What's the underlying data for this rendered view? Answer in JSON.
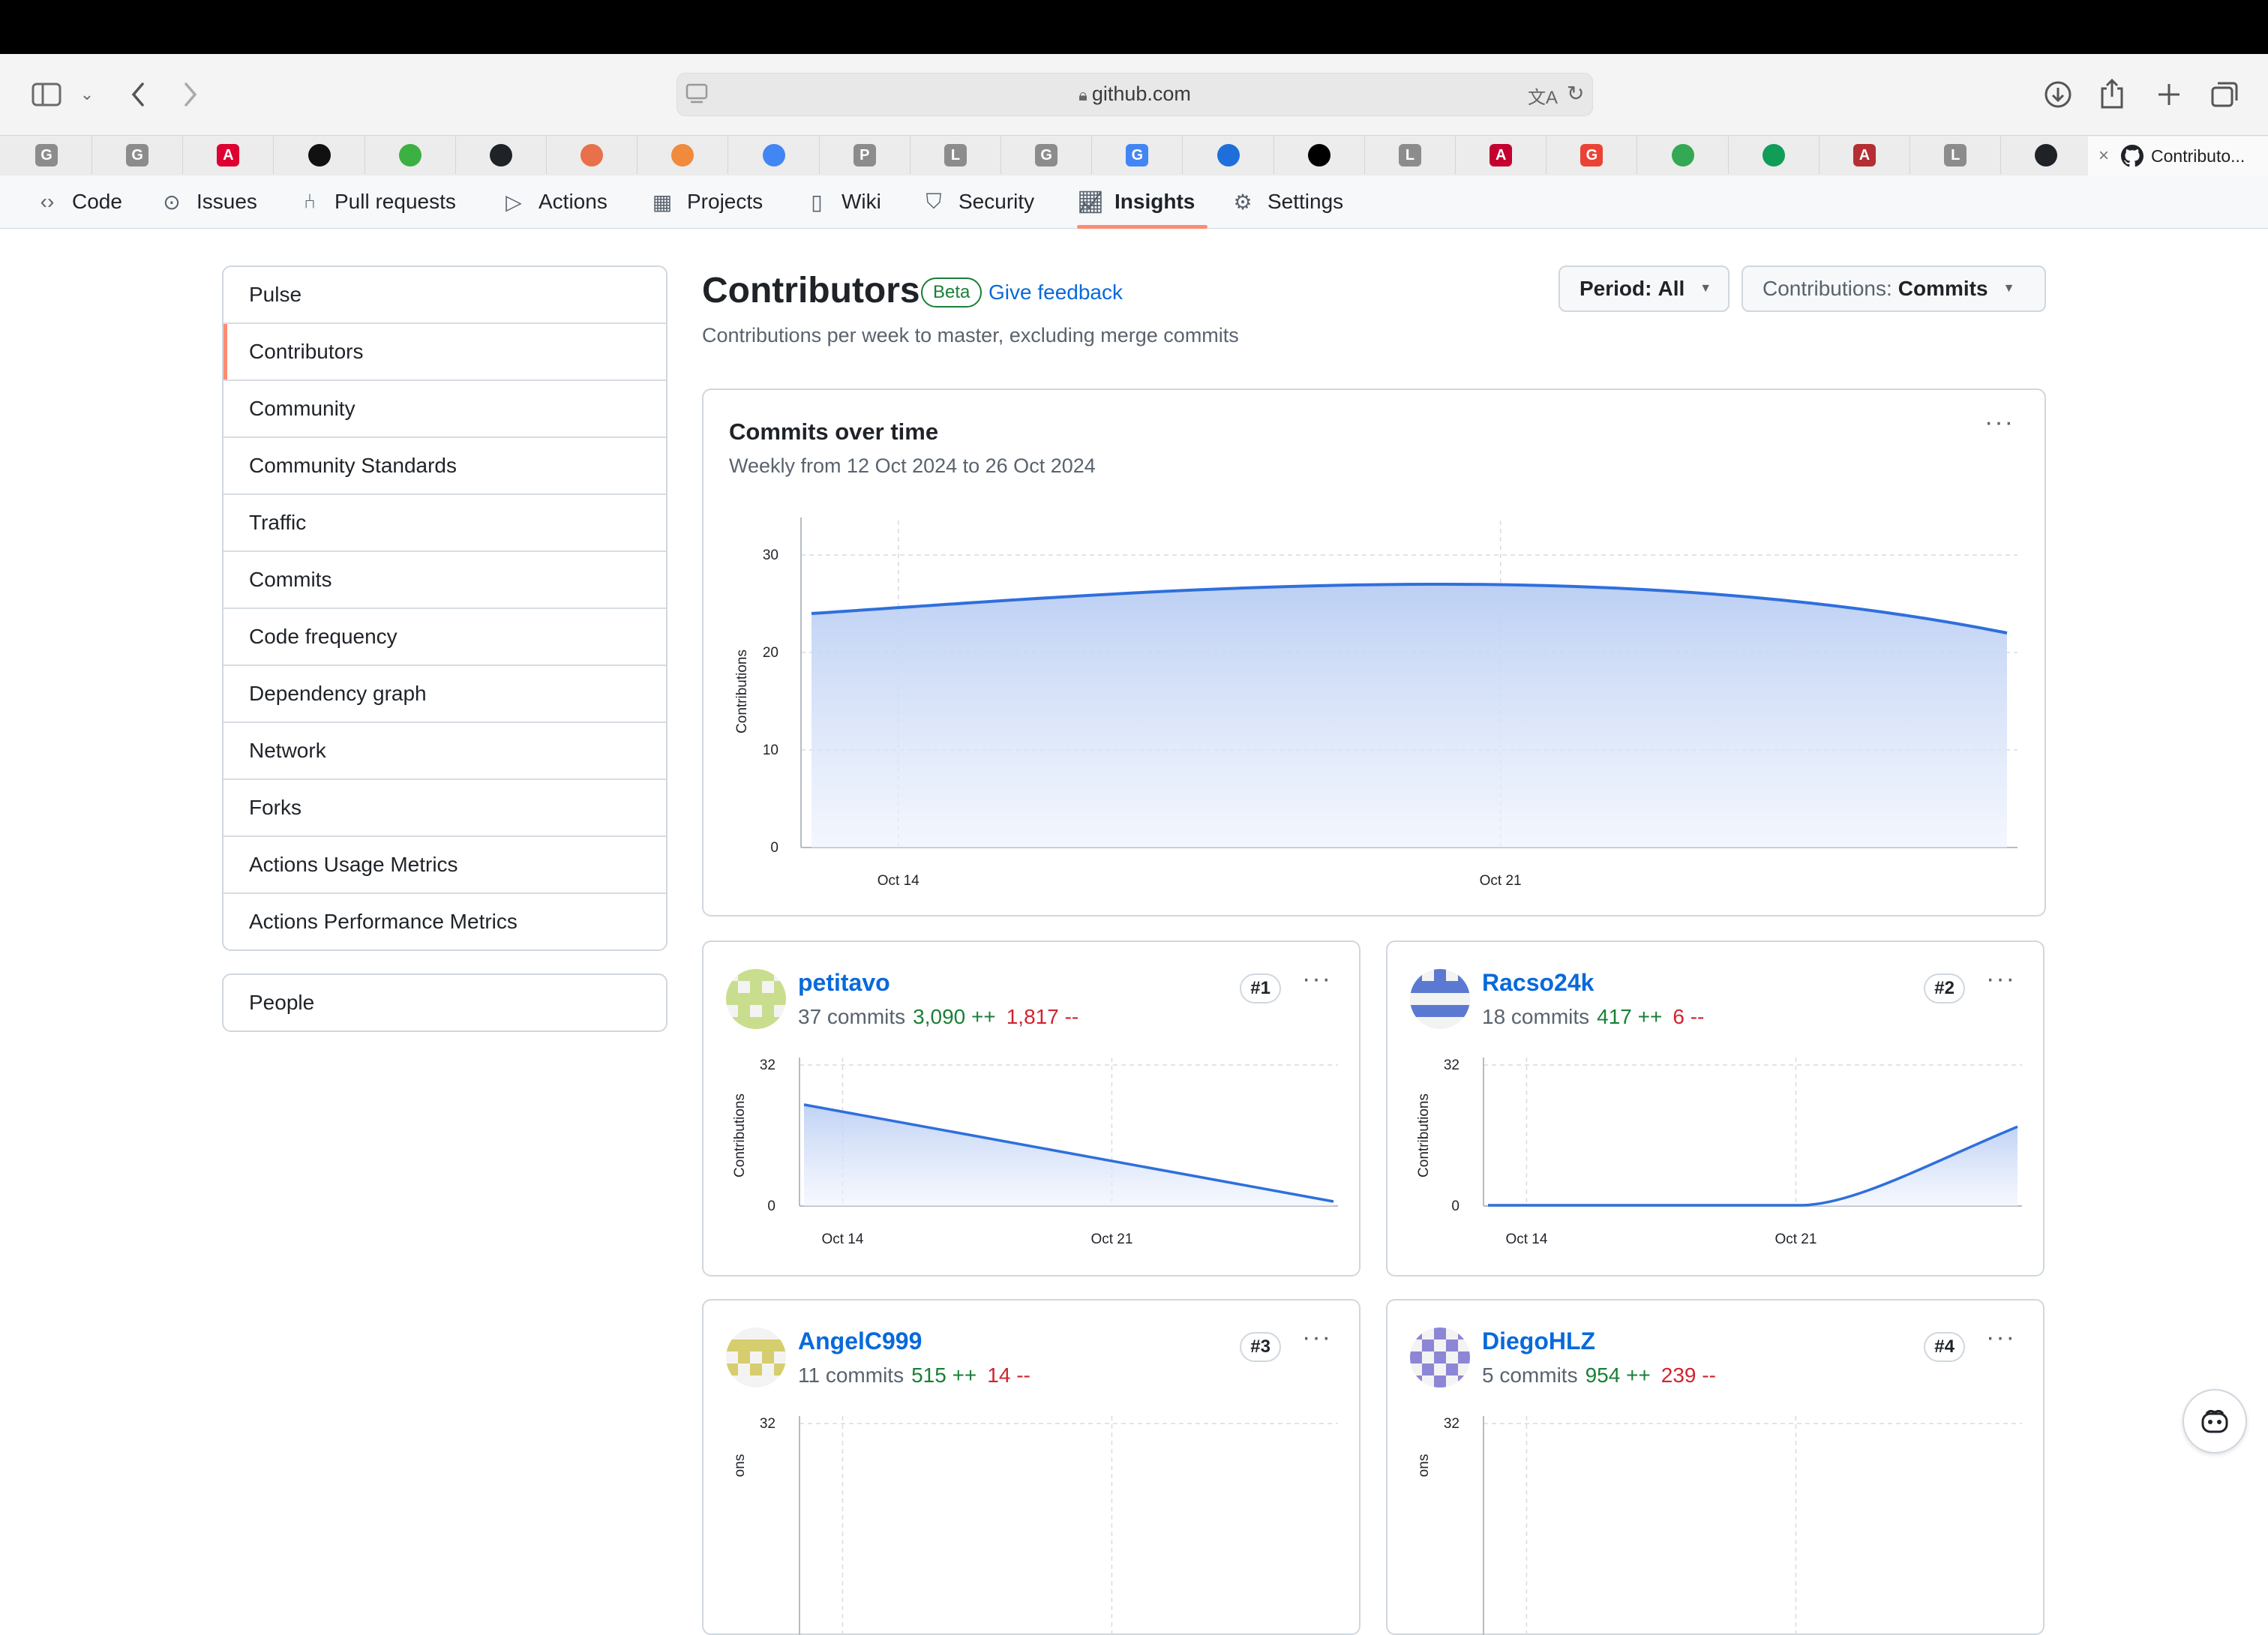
{
  "browser": {
    "url": "github.com",
    "active_tab_title": "Contributo...",
    "tabs": [
      {
        "icon": "letter-g-icon",
        "letter": "G",
        "color": "#8c8c8c"
      },
      {
        "icon": "letter-g-icon",
        "letter": "G",
        "color": "#8c8c8c"
      },
      {
        "icon": "angular-icon",
        "letter": "A",
        "color": "#dd0031"
      },
      {
        "icon": "circle-logo-icon",
        "letter": "",
        "color": "#111111"
      },
      {
        "icon": "green-circle-icon",
        "letter": "",
        "color": "#3cb043"
      },
      {
        "icon": "github-icon",
        "letter": "",
        "color": "#1f2328"
      },
      {
        "icon": "flower-icon",
        "letter": "",
        "color": "#e8704a"
      },
      {
        "icon": "flower-icon",
        "letter": "",
        "color": "#f08a3c"
      },
      {
        "icon": "docs-icon",
        "letter": "",
        "color": "#4285f4"
      },
      {
        "icon": "letter-p-icon",
        "letter": "P",
        "color": "#8c8c8c"
      },
      {
        "icon": "letter-l-icon",
        "letter": "L",
        "color": "#8c8c8c"
      },
      {
        "icon": "letter-g-icon",
        "letter": "G",
        "color": "#8c8c8c"
      },
      {
        "icon": "google-icon",
        "letter": "G",
        "color": "#4285f4"
      },
      {
        "icon": "blue-logo-icon",
        "letter": "",
        "color": "#1e6fd9"
      },
      {
        "icon": "dark-logo-icon",
        "letter": "",
        "color": "#000000"
      },
      {
        "icon": "letter-l-icon",
        "letter": "L",
        "color": "#8c8c8c"
      },
      {
        "icon": "angular-icon",
        "letter": "A",
        "color": "#c3002f"
      },
      {
        "icon": "google-icon",
        "letter": "G",
        "color": "#ea4335"
      },
      {
        "icon": "drive-icon",
        "letter": "",
        "color": "#34a853"
      },
      {
        "icon": "sheets-icon",
        "letter": "",
        "color": "#0f9d58"
      },
      {
        "icon": "angular-icon",
        "letter": "A",
        "color": "#b52e31"
      },
      {
        "icon": "letter-l-icon",
        "letter": "L",
        "color": "#8c8c8c"
      },
      {
        "icon": "github-icon",
        "letter": "",
        "color": "#1f2328"
      }
    ]
  },
  "repo_nav": [
    {
      "label": "Code",
      "icon": "code-icon"
    },
    {
      "label": "Issues",
      "icon": "issue-icon"
    },
    {
      "label": "Pull requests",
      "icon": "pull-request-icon"
    },
    {
      "label": "Actions",
      "icon": "play-icon"
    },
    {
      "label": "Projects",
      "icon": "table-icon"
    },
    {
      "label": "Wiki",
      "icon": "book-icon"
    },
    {
      "label": "Security",
      "icon": "shield-icon"
    },
    {
      "label": "Insights",
      "icon": "graph-icon",
      "active": true
    },
    {
      "label": "Settings",
      "icon": "gear-icon"
    }
  ],
  "sidebar": {
    "items": [
      "Pulse",
      "Contributors",
      "Community",
      "Community Standards",
      "Traffic",
      "Commits",
      "Code frequency",
      "Dependency graph",
      "Network",
      "Forks",
      "Actions Usage Metrics",
      "Actions Performance Metrics"
    ],
    "selected": "Contributors",
    "people": "People"
  },
  "header": {
    "title": "Contributors",
    "badge": "Beta",
    "feedback": "Give feedback",
    "subtitle": "Contributions per week to master, excluding merge commits",
    "period_label": "Period:",
    "period_value": "All",
    "contrib_label": "Contributions:",
    "contrib_value": "Commits"
  },
  "main_chart": {
    "title": "Commits over time",
    "subtitle": "Weekly from 12 Oct 2024 to 26 Oct 2024",
    "ylabel": "Contributions",
    "yticks": [
      "0",
      "10",
      "20",
      "30"
    ],
    "xticks": [
      "Oct 14",
      "Oct 21"
    ],
    "accent": "#2f6fdc"
  },
  "contributors": [
    {
      "name": "petitavo",
      "commits": "37 commits",
      "additions": "3,090 ++",
      "deletions": "1,817 --",
      "rank": "#1",
      "avatar_color": "#c9dd8e"
    },
    {
      "name": "Racso24k",
      "commits": "18 commits",
      "additions": "417 ++",
      "deletions": "6 --",
      "rank": "#2",
      "avatar_color": "#5b79d0"
    },
    {
      "name": "AngelC999",
      "commits": "11 commits",
      "additions": "515 ++",
      "deletions": "14 --",
      "rank": "#3",
      "avatar_color": "#d6cd6e"
    },
    {
      "name": "DiegoHLZ",
      "commits": "5 commits",
      "additions": "954 ++",
      "deletions": "239 --",
      "rank": "#4",
      "avatar_color": "#8d86d6"
    }
  ],
  "contrib_chart": {
    "ylabel": "Contributions",
    "ylabel_cut": "ons",
    "ymax": "32",
    "ymin": "0",
    "xticks": [
      "Oct 14",
      "Oct 21"
    ]
  },
  "chart_data": [
    {
      "type": "area",
      "title": "Commits over time",
      "subtitle": "Weekly from 12 Oct 2024 to 26 Oct 2024",
      "ylabel": "Contributions",
      "x": [
        "12 Oct 2024",
        "19 Oct 2024",
        "26 Oct 2024"
      ],
      "values": [
        24,
        27,
        22
      ],
      "ylim": [
        0,
        32
      ],
      "xticks": [
        "Oct 14",
        "Oct 21"
      ]
    },
    {
      "type": "area",
      "series": [
        {
          "name": "petitavo",
          "values": [
            23,
            12,
            0
          ]
        }
      ],
      "x": [
        "12 Oct 2024",
        "19 Oct 2024",
        "26 Oct 2024"
      ],
      "ylabel": "Contributions",
      "ylim": [
        0,
        32
      ]
    },
    {
      "type": "area",
      "series": [
        {
          "name": "Racso24k",
          "values": [
            0,
            0,
            18
          ]
        }
      ],
      "x": [
        "12 Oct 2024",
        "19 Oct 2024",
        "26 Oct 2024"
      ],
      "ylabel": "Contributions",
      "ylim": [
        0,
        32
      ]
    }
  ]
}
